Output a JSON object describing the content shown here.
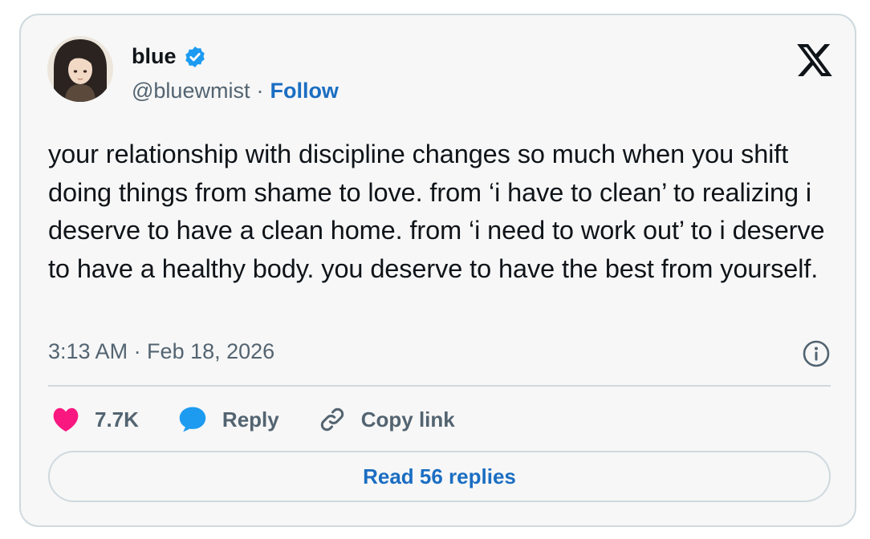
{
  "author": {
    "display_name": "blue",
    "handle": "@bluewmist",
    "separator": "·",
    "follow_label": "Follow"
  },
  "tweet": {
    "text": "your relationship with discipline changes so much when you shift doing things from shame to love. from ‘i have to clean’ to realizing i deserve to have a clean home. from ‘i need to work out’ to i deserve to have a healthy body. you deserve to have the best from yourself.",
    "timestamp": "3:13 AM · Feb 18, 2026"
  },
  "actions": {
    "likes_count": "7.7K",
    "reply_label": "Reply",
    "copy_link_label": "Copy link"
  },
  "footer": {
    "read_replies_label": "Read 56 replies"
  },
  "icons": {
    "logo": "x-logo-icon",
    "verified": "verified-badge-icon",
    "info": "info-icon",
    "like": "heart-icon",
    "reply": "speech-bubble-icon",
    "link": "link-icon"
  },
  "colors": {
    "background": "#f7f7f7",
    "text": "#0f1419",
    "secondary_text": "#536471",
    "link_blue": "#1b6ec2",
    "verified_blue": "#1d9bf0",
    "heart_pink": "#f91880",
    "border": "#cfd9de"
  }
}
